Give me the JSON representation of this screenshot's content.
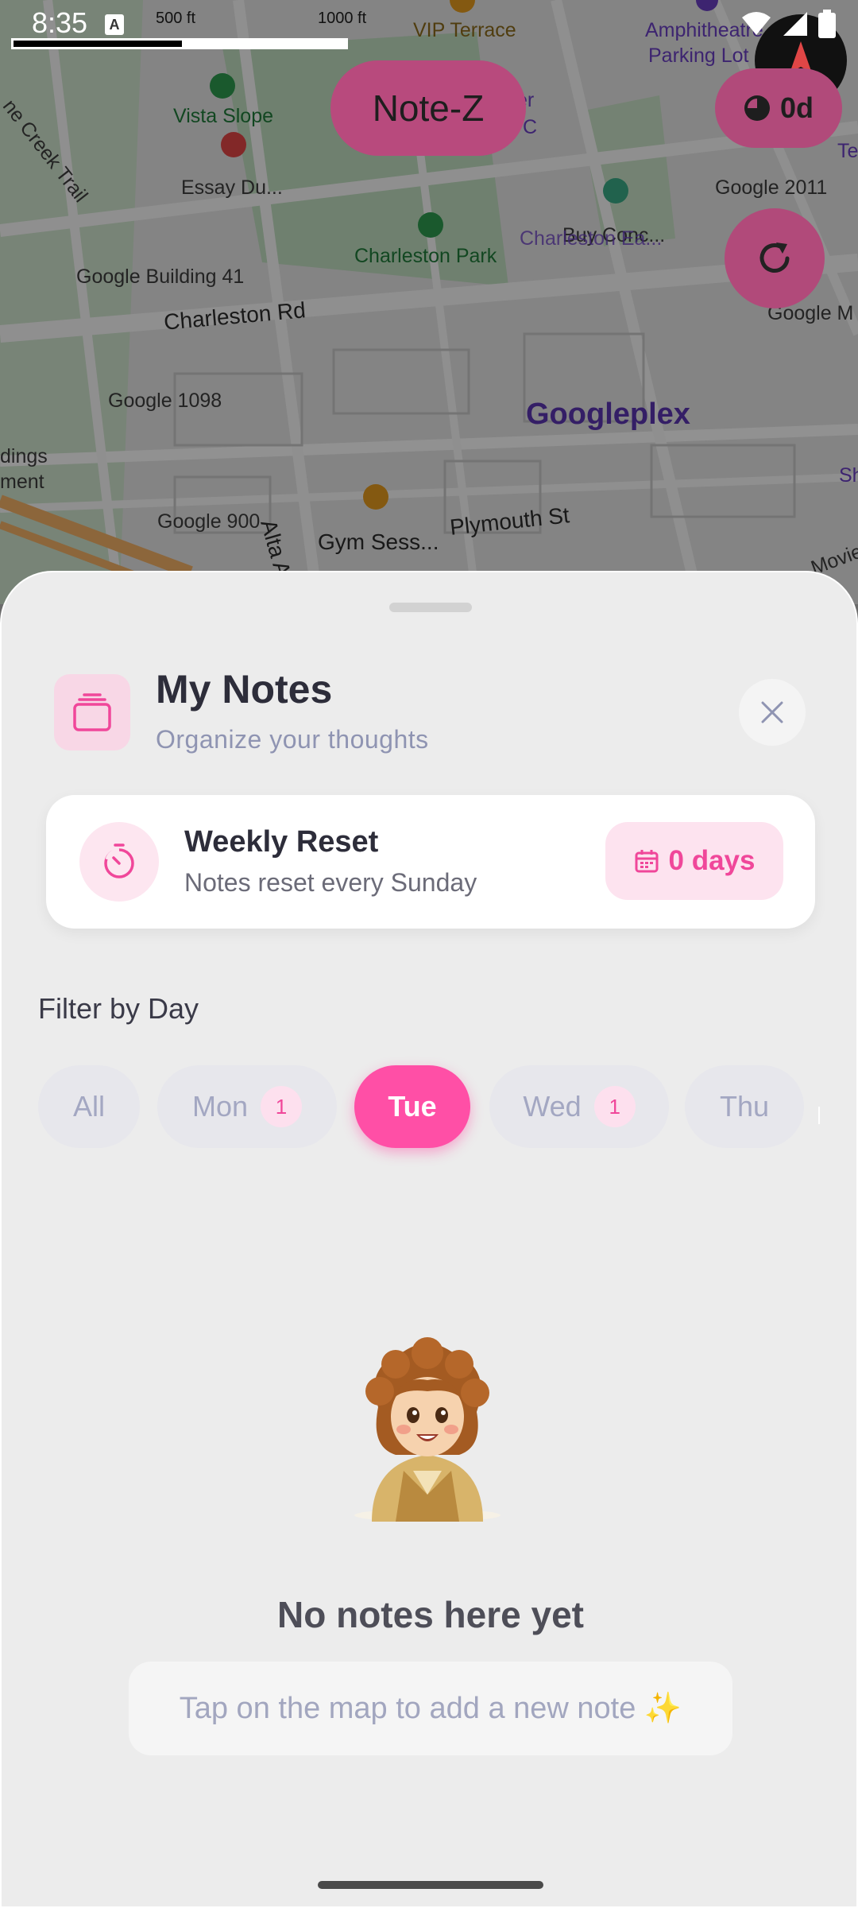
{
  "status_bar": {
    "time": "8:35",
    "scale_small": "500 ft",
    "scale_large": "1000 ft"
  },
  "map": {
    "labels": {
      "vip_terrace": "VIP Terrace",
      "amphitheatre": "Amphitheatre",
      "parking_lot": "Parking Lot",
      "creek_trail": "ne Creek Trail",
      "vista_slope": "Vista Slope",
      "essay": "Essay Du...",
      "google_building_41": "Google Building 41",
      "charleston_park": "Charleston Park",
      "charleston_rd": "Charleston Rd",
      "google_2011": "Google 2011",
      "buy_conc": "Buy Conc...",
      "charleston_east": "Charleston Ea...",
      "google_mv": "Google M",
      "google_1098": "Google 1098",
      "googleplex": "Googleplex",
      "dings": "dings",
      "ment": "ment",
      "google_900": "Google 900",
      "gym": "Gym Sess...",
      "plymouth": "Plymouth St",
      "alta": "Alta A",
      "movie": "Movie",
      "er": "er",
      "c": "C",
      "te": "Te",
      "sh": "Sh"
    },
    "app_title": "Note-Z",
    "timer_label": "0d"
  },
  "sheet": {
    "header": {
      "title": "My Notes",
      "subtitle": "Organize your thoughts"
    },
    "reset_card": {
      "title": "Weekly Reset",
      "subtitle": "Notes reset every Sunday",
      "days_label": "0 days"
    },
    "filter": {
      "label": "Filter by Day",
      "chips": [
        {
          "label": "All",
          "count": "",
          "active": false
        },
        {
          "label": "Mon",
          "count": "1",
          "active": false
        },
        {
          "label": "Tue",
          "count": "",
          "active": true
        },
        {
          "label": "Wed",
          "count": "1",
          "active": false
        },
        {
          "label": "Thu",
          "count": "",
          "active": false
        }
      ]
    },
    "empty_state": {
      "title": "No notes here yet",
      "hint": "Tap on the map to add a new note ✨"
    }
  },
  "colors": {
    "accent": "#ff4fa6",
    "accent_soft": "#fde3ef",
    "sheet_bg": "#ececec",
    "title_text": "#2d2d3a",
    "muted_text": "#8f94b2"
  }
}
